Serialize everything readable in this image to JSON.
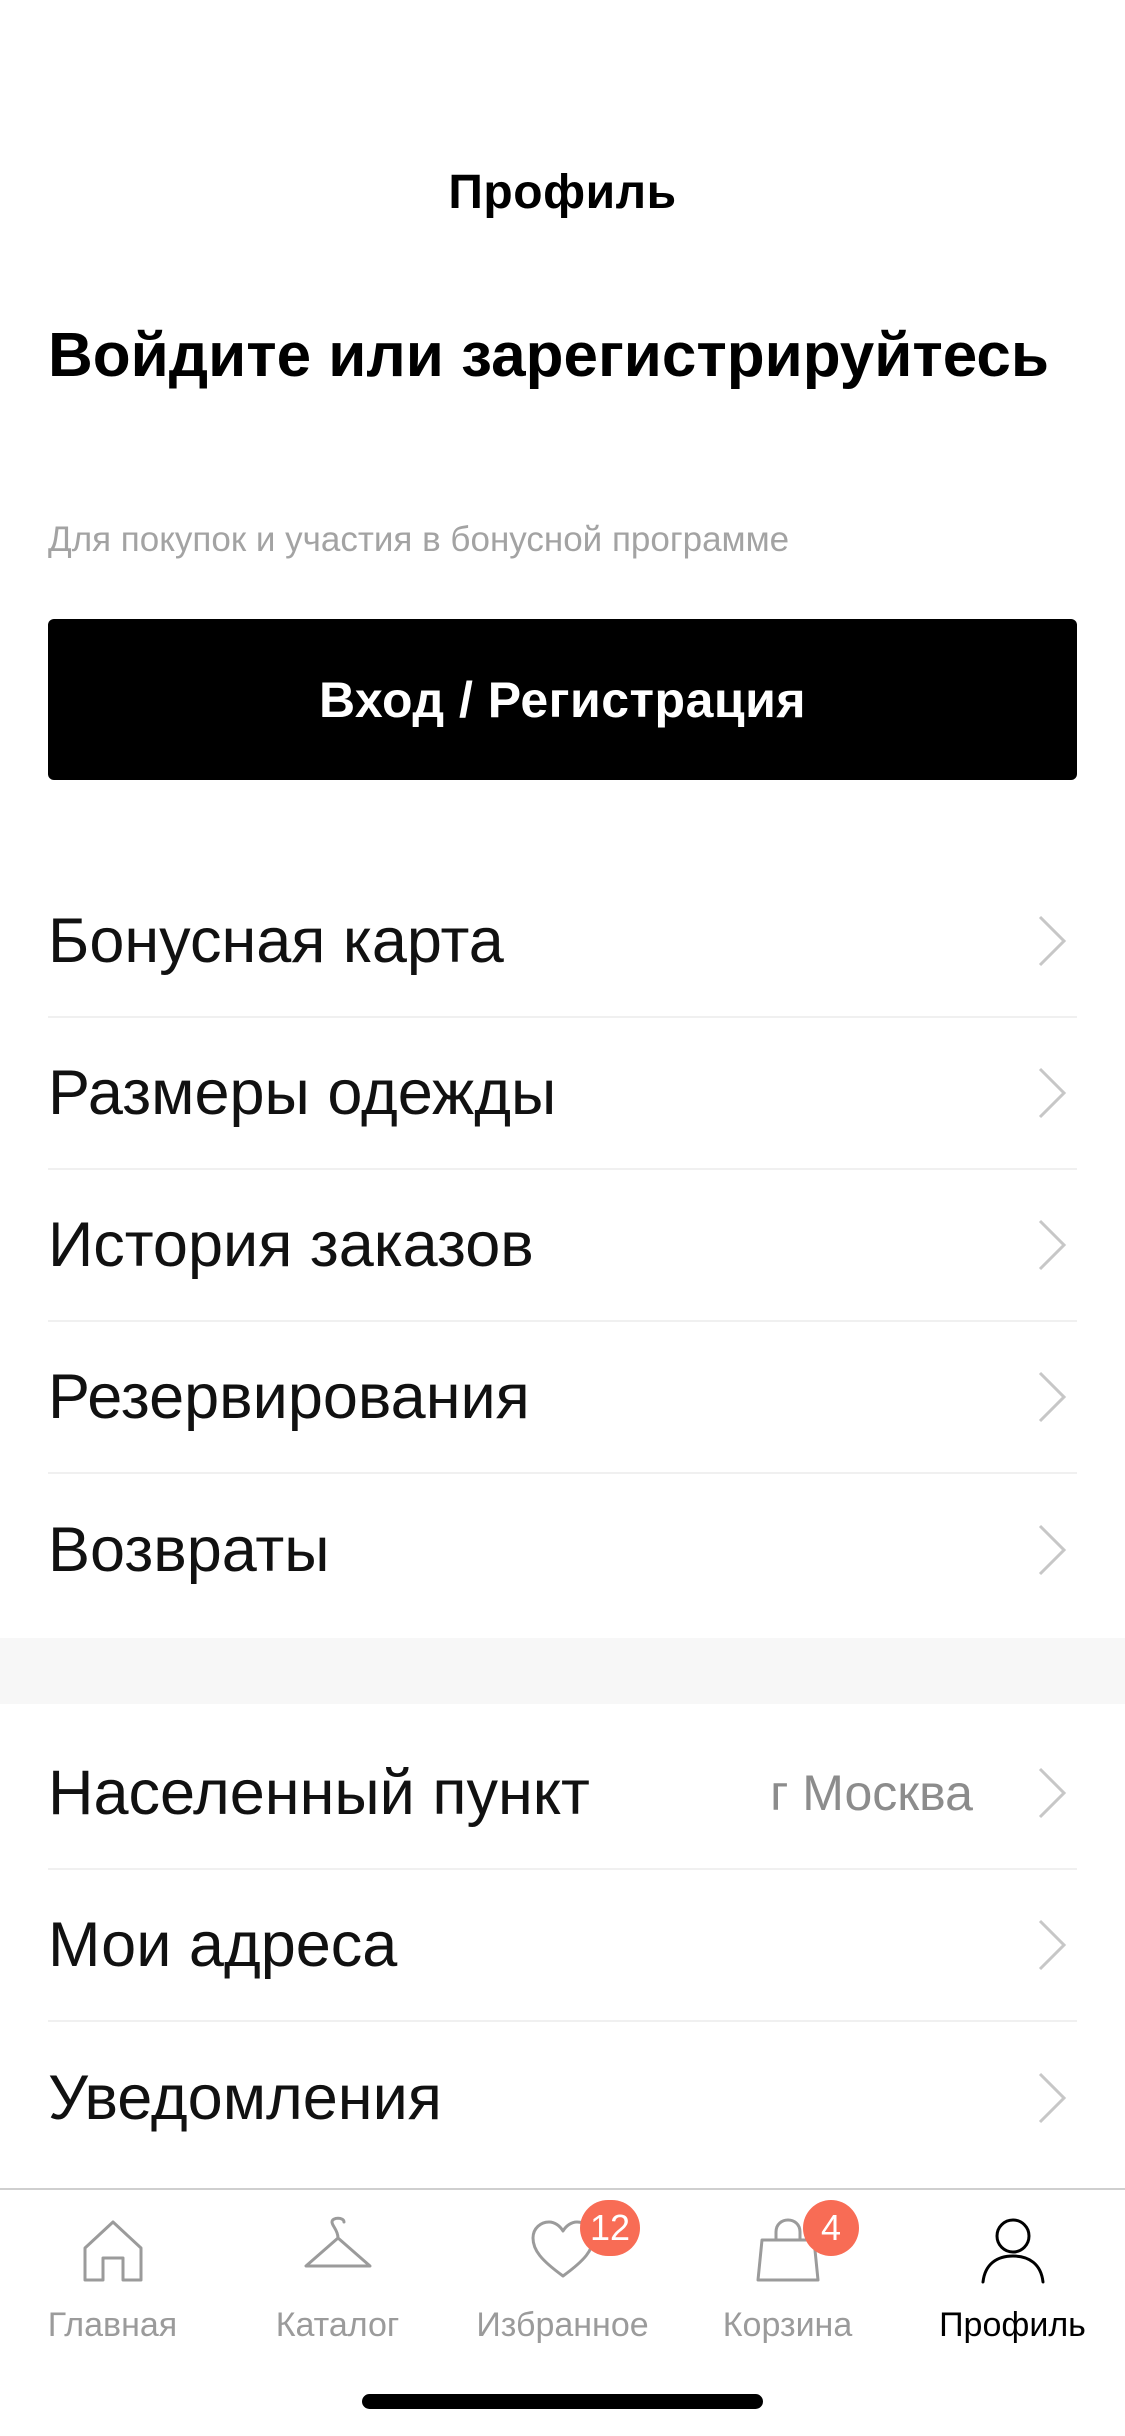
{
  "header": {
    "title": "Профиль"
  },
  "login": {
    "heading": "Войдите или зарегистрируйтесь",
    "subtitle": "Для покупок и участия в бонусной программе",
    "button_label": "Вход / Регистрация"
  },
  "menu_primary": [
    {
      "label": "Бонусная карта"
    },
    {
      "label": "Размеры одежды"
    },
    {
      "label": "История заказов"
    },
    {
      "label": "Резервирования"
    },
    {
      "label": "Возвраты"
    }
  ],
  "menu_secondary": [
    {
      "label": "Населенный пункт",
      "value": "г Москва"
    },
    {
      "label": "Мои адреса"
    },
    {
      "label": "Уведомления"
    }
  ],
  "tab_bar": {
    "tabs": [
      {
        "label": "Главная",
        "icon": "home-icon"
      },
      {
        "label": "Каталог",
        "icon": "hanger-icon"
      },
      {
        "label": "Избранное",
        "icon": "heart-icon",
        "badge": "12"
      },
      {
        "label": "Корзина",
        "icon": "bag-icon",
        "badge": "4"
      },
      {
        "label": "Профиль",
        "icon": "person-icon",
        "active": true
      }
    ]
  },
  "colors": {
    "accent_badge": "#f86c55",
    "primary_button": "#000000",
    "muted_text": "#a3a3a3",
    "divider": "#f0f0f0"
  }
}
